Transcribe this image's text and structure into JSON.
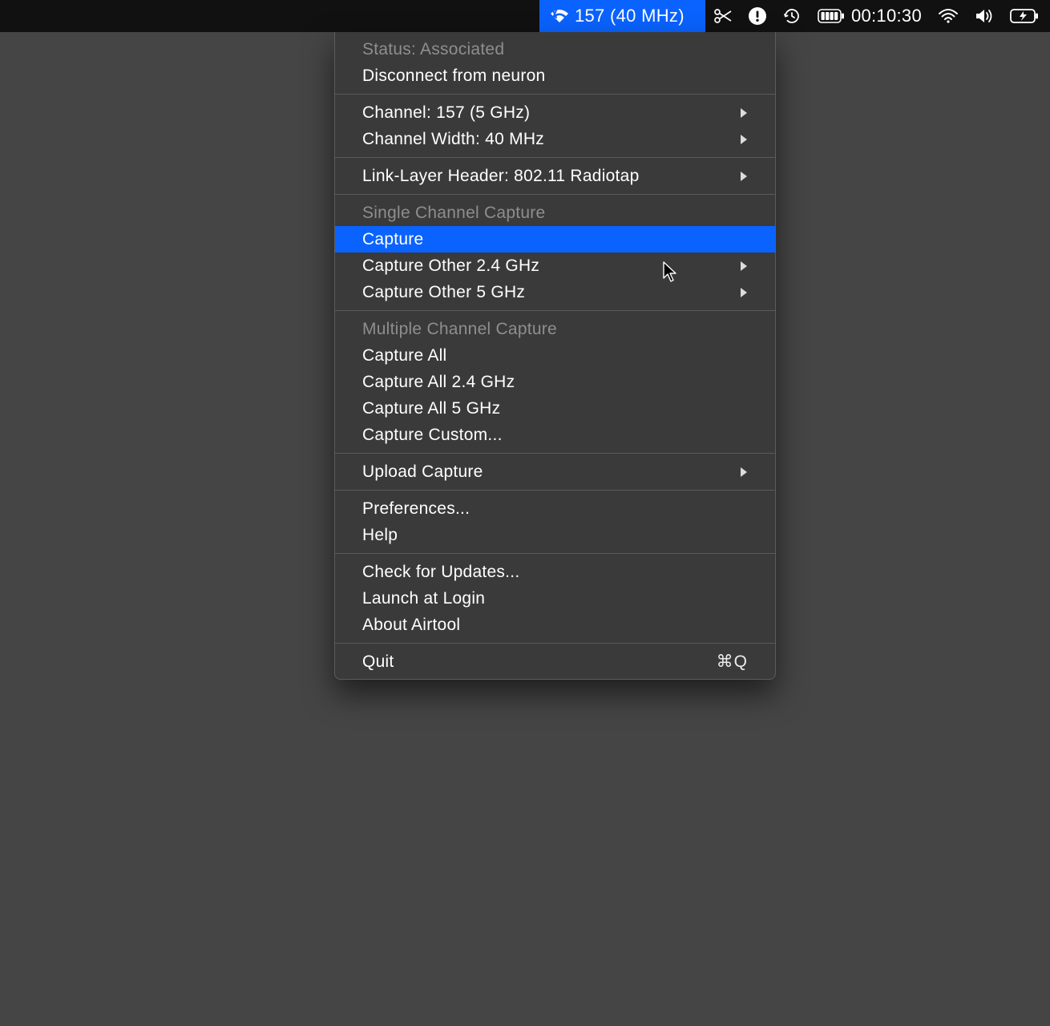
{
  "menubar": {
    "active_app_label": "157 (40 MHz)",
    "timer": "00:10:30"
  },
  "menu": {
    "status_label": "Status: Associated",
    "disconnect_label": "Disconnect from neuron",
    "channel_label": "Channel: 157 (5 GHz)",
    "channel_width_label": "Channel Width: 40 MHz",
    "link_layer_label": "Link-Layer Header: 802.11 Radiotap",
    "single_cap_header": "Single Channel Capture",
    "capture_label": "Capture",
    "capture_other_24_label": "Capture Other 2.4 GHz",
    "capture_other_5_label": "Capture Other 5 GHz",
    "multi_cap_header": "Multiple Channel Capture",
    "capture_all_label": "Capture All",
    "capture_all_24_label": "Capture All 2.4 GHz",
    "capture_all_5_label": "Capture All 5 GHz",
    "capture_custom_label": "Capture Custom...",
    "upload_label": "Upload Capture",
    "preferences_label": "Preferences...",
    "help_label": "Help",
    "check_updates_label": "Check for Updates...",
    "launch_login_label": "Launch at Login",
    "about_label": "About Airtool",
    "quit_label": "Quit",
    "quit_shortcut": "⌘Q"
  }
}
